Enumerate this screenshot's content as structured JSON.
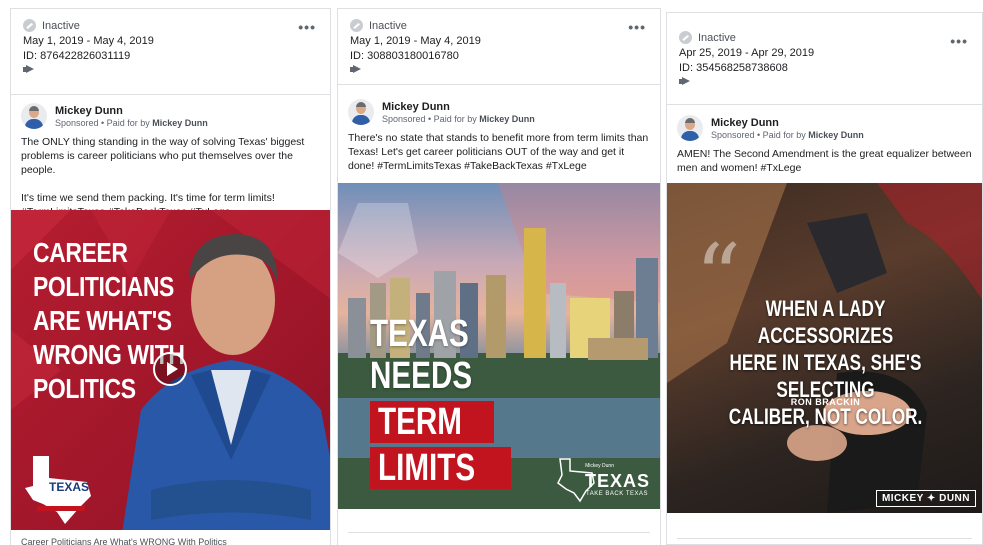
{
  "ads": [
    {
      "status": "Inactive",
      "date_range": "May 1, 2019 - May 4, 2019",
      "id": "ID: 876422826031119",
      "more": "•••",
      "author": "Mickey Dunn",
      "sponsored": "Sponsored • Paid for by",
      "paid_by": "Mickey Dunn",
      "text": [
        "The ONLY thing standing in the way of solving Texas' biggest problems is career politicians who put themselves over the people.",
        "It's time we send them packing. It's time for term limits! #TermLimitsTexas #TakeBackTexas #TxLege"
      ],
      "creative_headline": "CAREER\nPOLITICIANS\nARE WHAT'S\nWRONG WITH\nPOLITICS",
      "logo_text": "TEXAS",
      "caption": "Career Politicians Are What's WRONG With Politics"
    },
    {
      "status": "Inactive",
      "date_range": "May 1, 2019 - May 4, 2019",
      "id": "ID: 308803180016780",
      "more": "•••",
      "author": "Mickey Dunn",
      "sponsored": "Sponsored • Paid for by",
      "paid_by": "Mickey Dunn",
      "text": [
        "There's no state that stands to benefit more from term limits than Texas! Let's get career politicians OUT of the way and get it done! #TermLimitsTexas #TakeBackTexas #TxLege"
      ],
      "creative_headline_1": "TEXAS",
      "creative_headline_2": "NEEDS",
      "creative_headline_3": "TERM",
      "creative_headline_4": "LIMITS",
      "logo_text": "TEXAS",
      "logo_sub": "TAKE BACK TEXAS",
      "logo_small": "Mickey Dunn"
    },
    {
      "status": "Inactive",
      "date_range": "Apr 25, 2019 - Apr 29, 2019",
      "id": "ID: 354568258738608",
      "more": "•••",
      "author": "Mickey Dunn",
      "sponsored": "Sponsored • Paid for by",
      "paid_by": "Mickey Dunn",
      "text": [
        "AMEN! The Second Amendment is the great equalizer between men and women! #TxLege"
      ],
      "quote_marks": "“",
      "quote": "WHEN A LADY ACCESSORIZES\nHERE IN TEXAS, SHE'S SELECTING\nCALIBER, NOT COLOR.",
      "quote_author": "RON BRACKIN",
      "brand": "MICKEY ✦ DUNN"
    }
  ]
}
